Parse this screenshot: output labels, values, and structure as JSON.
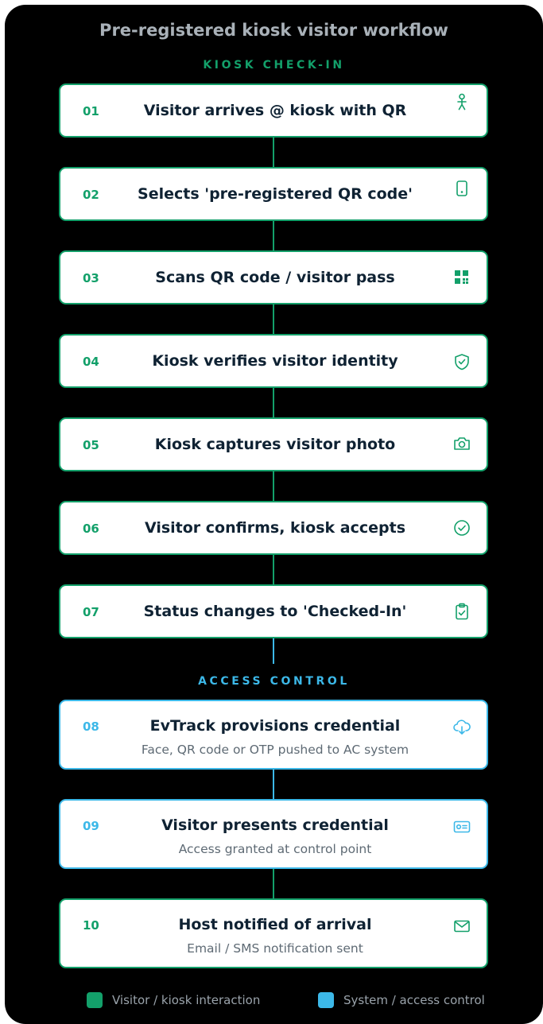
{
  "title": "Pre-registered kiosk visitor workflow",
  "sections": {
    "kiosk": "KIOSK CHECK-IN",
    "access": "ACCESS CONTROL"
  },
  "colors": {
    "kiosk": "#13a06a",
    "access": "#3cb8e8",
    "title": "#a9b1b8",
    "text": "#0f2233",
    "subtext": "#5e6a74"
  },
  "steps": [
    {
      "num": "01",
      "title": "Visitor arrives @ kiosk with QR",
      "icon": "person-icon"
    },
    {
      "num": "02",
      "title": "Selects 'pre-registered QR code'",
      "icon": "phone-icon"
    },
    {
      "num": "03",
      "title": "Scans QR code / visitor pass",
      "icon": "qr-icon"
    },
    {
      "num": "04",
      "title": "Kiosk verifies visitor identity",
      "icon": "shield-check-icon"
    },
    {
      "num": "05",
      "title": "Kiosk captures visitor photo",
      "icon": "camera-icon"
    },
    {
      "num": "06",
      "title": "Visitor confirms, kiosk accepts",
      "icon": "check-circle-icon"
    },
    {
      "num": "07",
      "title": "Status changes to 'Checked-In'",
      "icon": "clipboard-check-icon"
    },
    {
      "num": "08",
      "title": "EvTrack provisions credential",
      "subtitle": "Face, QR code or OTP pushed to AC system",
      "icon": "cloud-download-icon"
    },
    {
      "num": "09",
      "title": "Visitor presents credential",
      "subtitle": "Access granted at control point",
      "icon": "id-card-icon"
    },
    {
      "num": "10",
      "title": "Host notified of arrival",
      "subtitle": "Email / SMS notification sent",
      "icon": "mail-icon"
    }
  ],
  "legend": [
    {
      "label": "Visitor / kiosk interaction",
      "color": "#13a06a"
    },
    {
      "label": "System / access control",
      "color": "#3cb8e8"
    }
  ]
}
